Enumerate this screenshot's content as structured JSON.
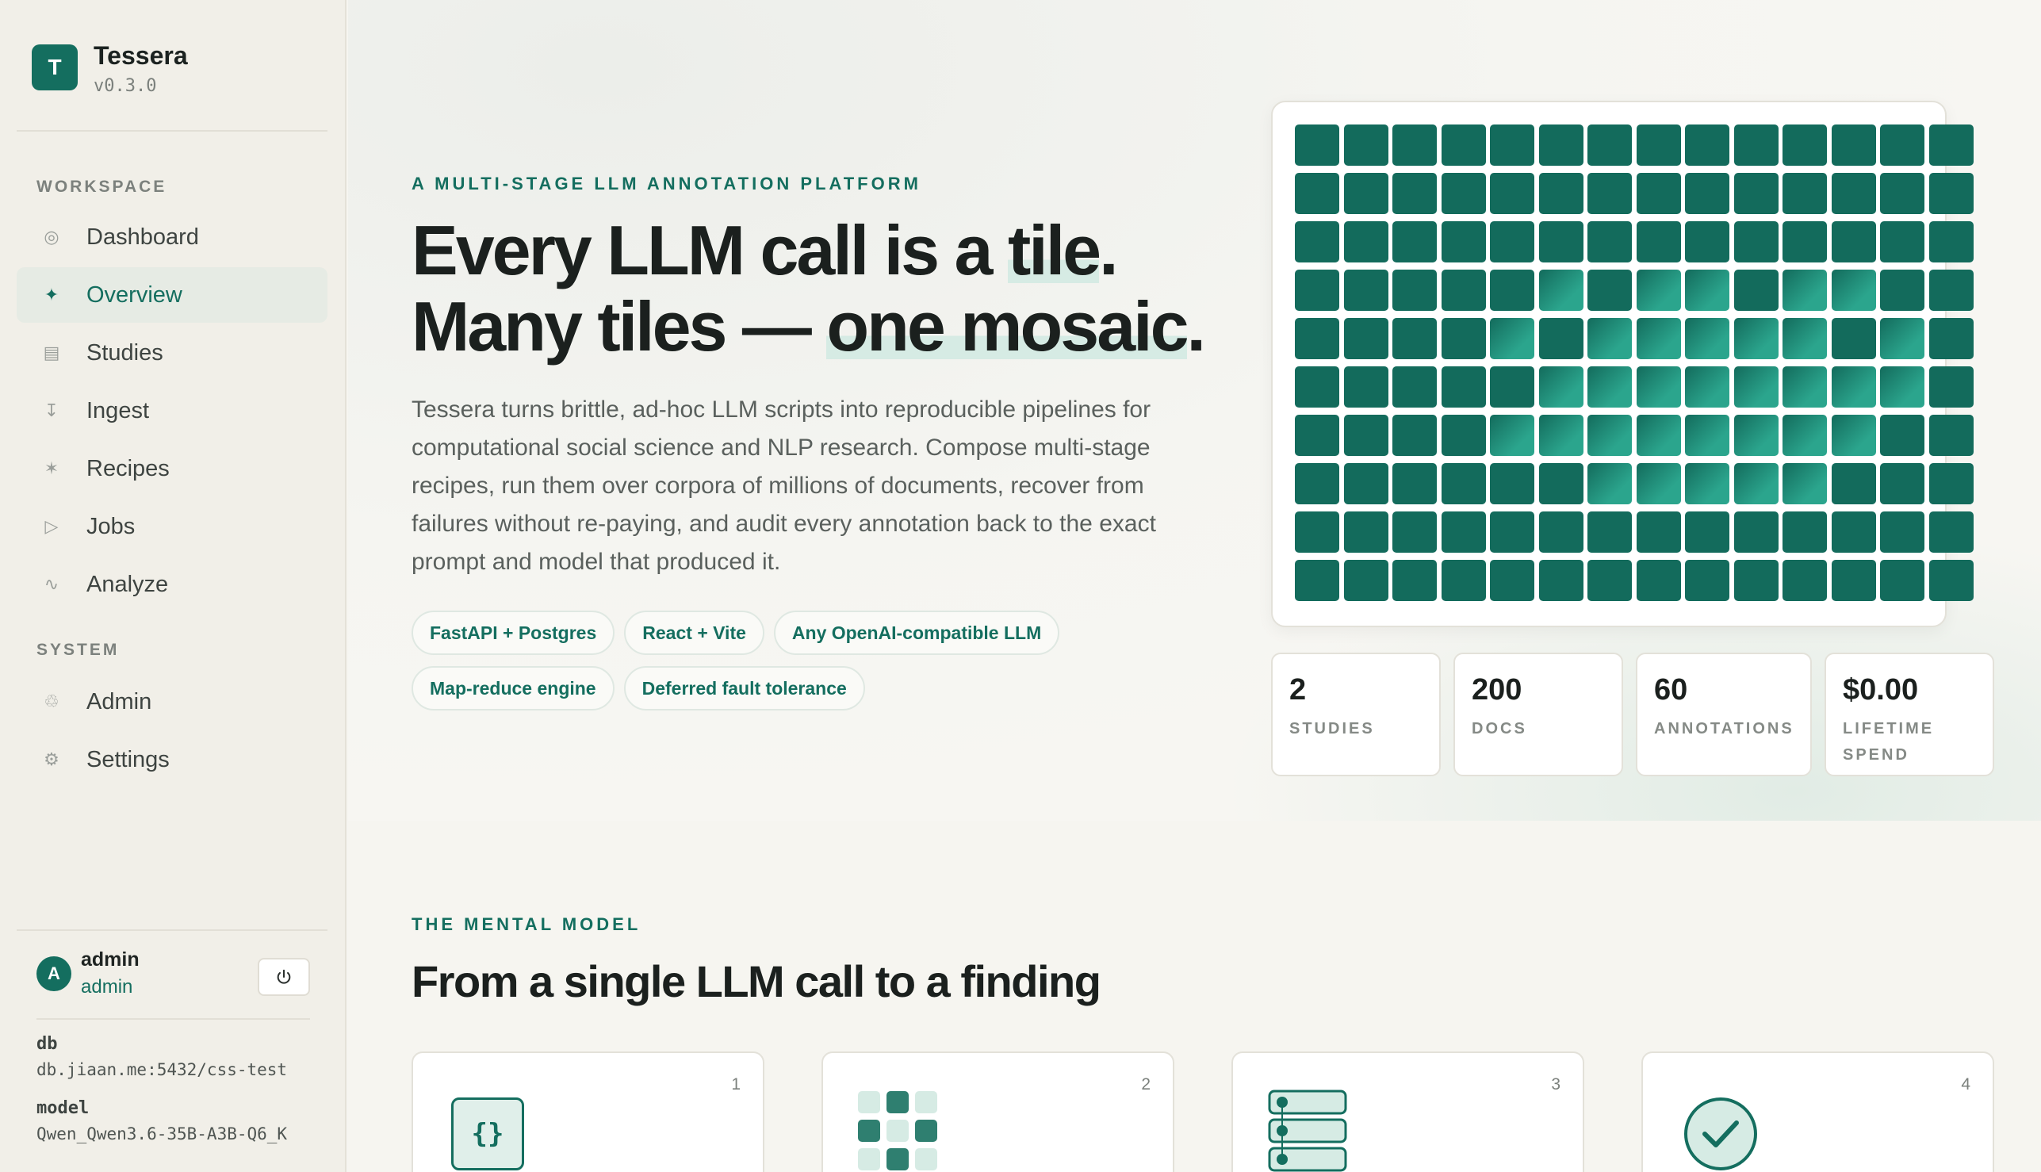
{
  "brand": {
    "logo_letter": "T",
    "name": "Tessera",
    "version": "v0.3.0"
  },
  "sidebar": {
    "workspace_heading": "WORKSPACE",
    "system_heading": "SYSTEM",
    "workspace_items": [
      {
        "label": "Dashboard",
        "icon": "dashboard-icon",
        "glyph": "◎"
      },
      {
        "label": "Overview",
        "icon": "sparkle-icon",
        "glyph": "✦"
      },
      {
        "label": "Studies",
        "icon": "studies-icon",
        "glyph": "▤"
      },
      {
        "label": "Ingest",
        "icon": "ingest-icon",
        "glyph": "↧"
      },
      {
        "label": "Recipes",
        "icon": "recipes-icon",
        "glyph": "✶"
      },
      {
        "label": "Jobs",
        "icon": "play-icon",
        "glyph": "▷"
      },
      {
        "label": "Analyze",
        "icon": "analyze-icon",
        "glyph": "∿"
      }
    ],
    "system_items": [
      {
        "label": "Admin",
        "icon": "admin-icon",
        "glyph": "♲"
      },
      {
        "label": "Settings",
        "icon": "gear-icon",
        "glyph": "⚙"
      }
    ],
    "active_item": "Overview",
    "user": {
      "avatar_letter": "A",
      "name": "admin",
      "role": "admin",
      "logout_icon": "power-icon"
    },
    "db_label": "db",
    "db_value": "db.jiaan.me:5432/css-test",
    "model_label": "model",
    "model_value": "Qwen_Qwen3.6-35B-A3B-Q6_K"
  },
  "hero": {
    "eyebrow": "A MULTI-STAGE LLM ANNOTATION PLATFORM",
    "headline_line1_pre": "Every LLM call is a ",
    "headline_line1_hl": "tile",
    "headline_line1_post": ".",
    "headline_line2_pre": "Many tiles — ",
    "headline_line2_hl": "one mosaic",
    "headline_line2_post": ".",
    "description": "Tessera turns brittle, ad-hoc LLM scripts into reproducible pipelines for computational social science and NLP research. Compose multi-stage recipes, run them over corpora of millions of documents, recover from failures without re-paying, and audit every annotation back to the exact prompt and model that produced it.",
    "tags": [
      "FastAPI + Postgres",
      "React + Vite",
      "Any OpenAI-compatible LLM",
      "Map-reduce engine",
      "Deferred fault tolerance"
    ]
  },
  "stats": [
    {
      "value": "2",
      "label": "STUDIES"
    },
    {
      "value": "200",
      "label": "DOCS"
    },
    {
      "value": "60",
      "label": "ANNOTATIONS"
    },
    {
      "value": "$0.00",
      "label": "LIFETIME SPEND"
    }
  ],
  "mental_model": {
    "eyebrow": "THE MENTAL MODEL",
    "title": "From a single LLM call to a finding",
    "steps": [
      {
        "number": "1",
        "icon": "json-braces-icon",
        "glyph": "{}"
      },
      {
        "number": "2",
        "icon": "tile-grid-icon"
      },
      {
        "number": "3",
        "icon": "pipeline-stack-icon"
      },
      {
        "number": "4",
        "icon": "check-circle-icon"
      }
    ]
  },
  "colors": {
    "accent": "#146e5f",
    "tile_dark": "#136b5c",
    "tile_light": "#2ba58d"
  }
}
